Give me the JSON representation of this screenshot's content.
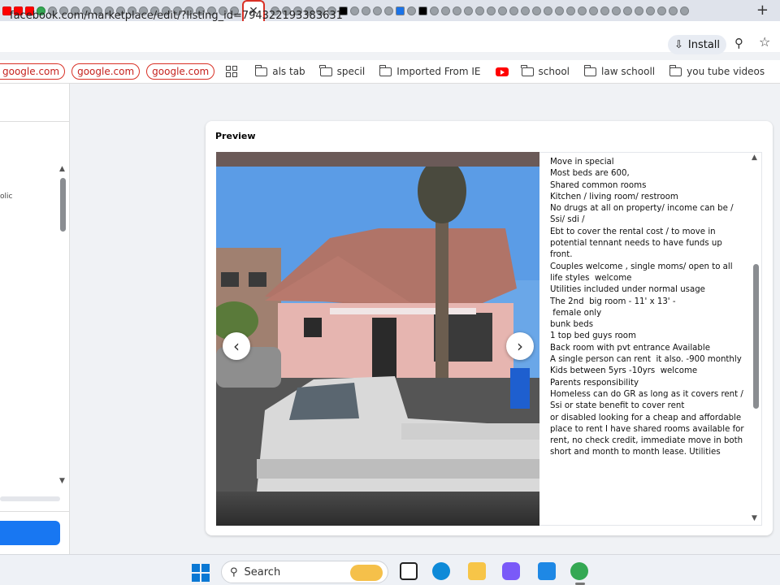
{
  "browser": {
    "url": "facebook.com/marketplace/edit/?listing_id=794322193383631",
    "install_label": "Install",
    "active_tab_close": "✕",
    "new_tab": "+"
  },
  "bookmarks": {
    "pills": [
      "google.com",
      "google.com",
      "google.com"
    ],
    "folders": [
      "als tab",
      "specil",
      "Imported From IE"
    ],
    "folders2": [
      "school",
      "law  schooll",
      "you tube videos"
    ]
  },
  "left_panel": {
    "partial_text": "olic"
  },
  "preview": {
    "title": "Preview",
    "description": [
      "Move in special",
      "Most beds are 600,",
      "",
      "Shared common rooms",
      "Kitchen / living room/ restroom",
      "No drugs at all on property/ income can be / Ssi/ sdi /",
      "Ebt to cover the rental cost / to move in potential tennant needs to have funds up front.",
      "Couples welcome , single moms/ open to all life styles  welcome",
      "Utilities included under normal usage",
      "",
      "The 2nd  big room - 11' x 13' -",
      " female only",
      "bunk beds",
      "",
      "1 top bed guys room",
      "",
      "Back room with pvt entrance Available",
      "A single person can rent  it also. -900 monthly",
      "",
      "Kids between 5yrs -10yrs  welcome",
      "Parents responsibility",
      "",
      "Homeless can do GR as long as it covers rent / Ssi or state benefit to cover rent",
      "",
      "or disabled looking for a cheap and affordable place to rent I have shared rooms available for rent, no check credit, immediate move in both short and month to month lease. Utilities"
    ]
  },
  "taskbar": {
    "search_label": "Search"
  }
}
